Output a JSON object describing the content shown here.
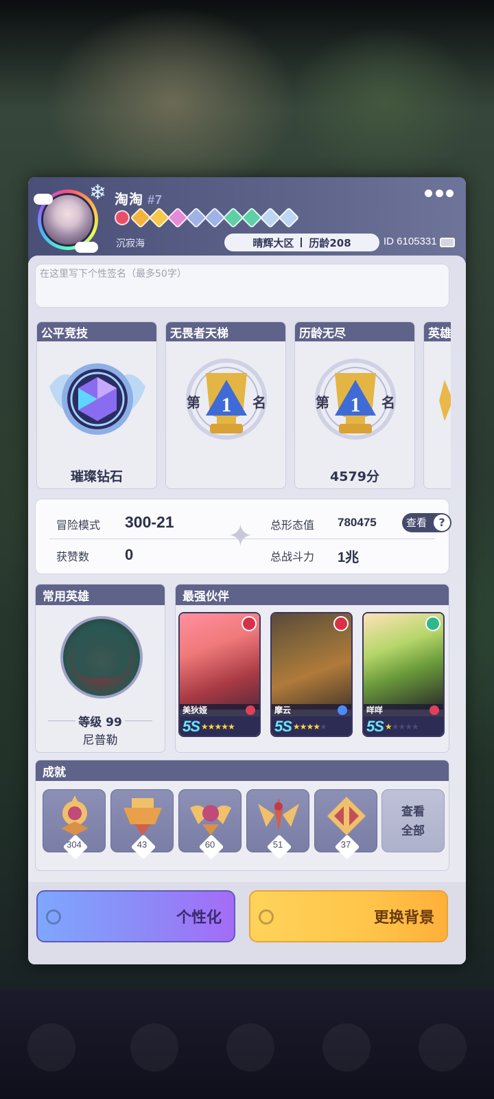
{
  "profile": {
    "name": "淘淘",
    "number": "#7",
    "motto": "沉寂海",
    "server": "晴辉大区",
    "seniority": "历龄208",
    "id": "ID 6105331"
  },
  "gems": [
    {
      "icon": "red-gem-icon",
      "color": "#e8506a"
    },
    {
      "icon": "orange-gem-icon",
      "color": "#f3b43c"
    },
    {
      "icon": "gold-gem-icon",
      "color": "#f5c84a"
    },
    {
      "icon": "pink-gem-icon",
      "color": "#e58ad6"
    },
    {
      "icon": "blue-gem-icon",
      "color": "#9fb2e6"
    },
    {
      "icon": "blue-gem-icon",
      "color": "#9fb2e6"
    },
    {
      "icon": "green-gem-icon",
      "color": "#5fd0a6"
    },
    {
      "icon": "green-gem-icon",
      "color": "#5fd0a6"
    },
    {
      "icon": "crystal-gem-icon",
      "color": "#bcd7f2"
    },
    {
      "icon": "crystal-gem-icon",
      "color": "#bcd7f2"
    }
  ],
  "signature": {
    "placeholder": "在这里写下个性签名（最多50字）"
  },
  "ranks": [
    {
      "title": "公平竞技",
      "label": "璀璨钻石"
    },
    {
      "title": "无畏者天梯",
      "label": "",
      "place_left": "第",
      "place_num": "1",
      "place_right": "名"
    },
    {
      "title": "历龄无尽",
      "label": "4579分",
      "place_left": "第",
      "place_num": "1",
      "place_right": "名"
    },
    {
      "title": "英雄",
      "label": ""
    }
  ],
  "stats": {
    "adventure_label": "冒险模式",
    "adventure_value": "300-21",
    "likes_label": "获赞数",
    "likes_value": "0",
    "form_label": "总形态值",
    "form_value": "780475",
    "power_label": "总战斗力",
    "power_value": "1兆",
    "view_label": "查看",
    "help_glyph": "?"
  },
  "hero": {
    "section_title": "常用英雄",
    "level": "等级 99",
    "name": "尼普勒"
  },
  "partners": {
    "section_title": "最强伙伴",
    "items": [
      {
        "name": "美狄娅",
        "grade": "5S",
        "stars_filled": 5,
        "stars_total": 5,
        "badge_color": "#d9304a",
        "elem_color": "#e0405a"
      },
      {
        "name": "摩云",
        "grade": "5S",
        "stars_filled": 4,
        "stars_total": 5,
        "badge_color": "#d9304a",
        "elem_color": "#4a8cff"
      },
      {
        "name": "咩咩",
        "grade": "5S",
        "stars_filled": 1,
        "stars_total": 5,
        "badge_color": "#2fb98a",
        "elem_color": "#e0405a"
      }
    ]
  },
  "achievements": {
    "section_title": "成就",
    "items": [
      {
        "icon": "sun-emblem-icon",
        "count": "304"
      },
      {
        "icon": "crown-emblem-icon",
        "count": "43"
      },
      {
        "icon": "wing-emblem-icon",
        "count": "60"
      },
      {
        "icon": "star-wing-emblem-icon",
        "count": "51"
      },
      {
        "icon": "cross-emblem-icon",
        "count": "37"
      }
    ],
    "view_all_line1": "查看",
    "view_all_line2": "全部"
  },
  "buttons": {
    "customize": "个性化",
    "change_background": "更换背景"
  },
  "colors": {
    "header": "#5f6389",
    "accent_purple": "#8b8cf7",
    "accent_gold": "#ffc54a"
  }
}
